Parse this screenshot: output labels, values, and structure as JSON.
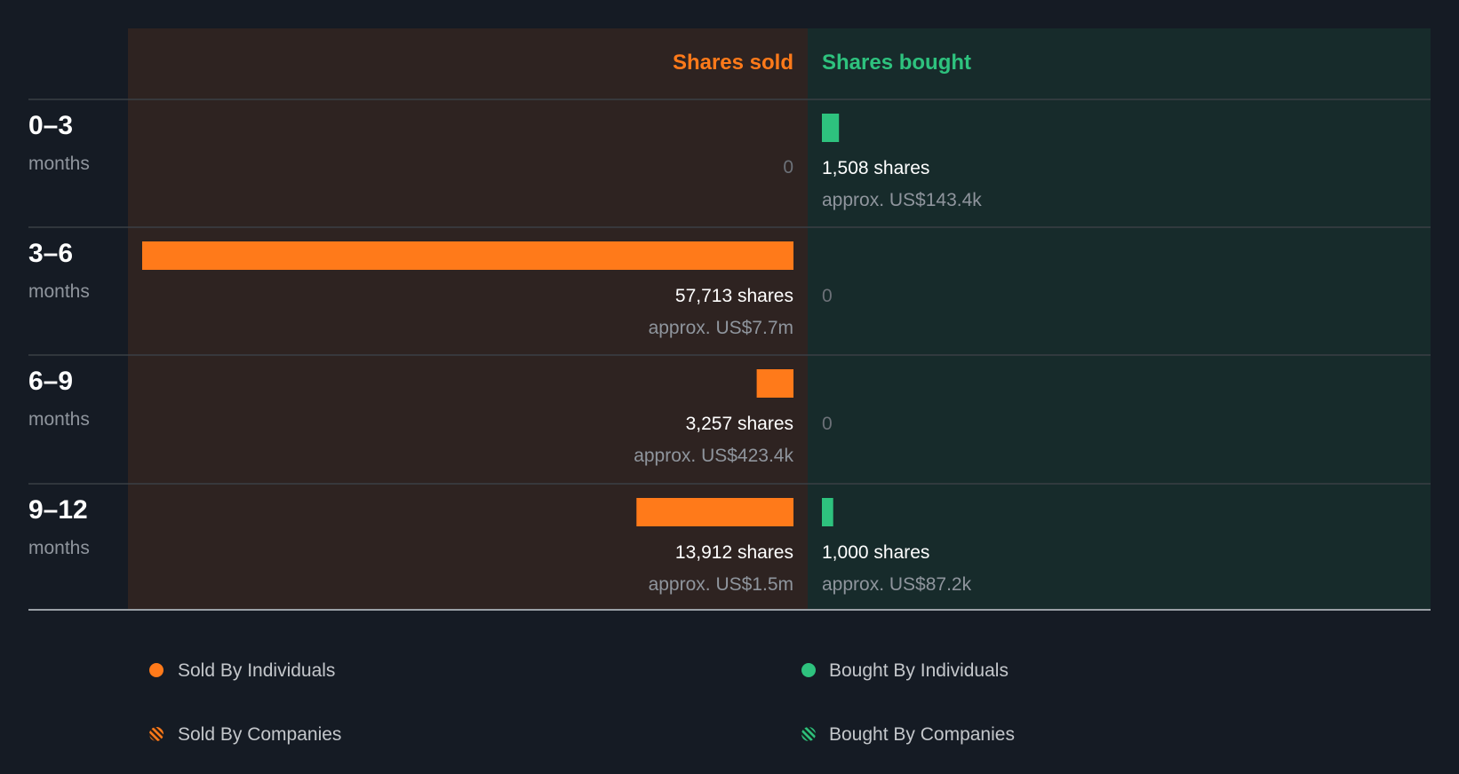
{
  "chart_data": {
    "type": "bar",
    "title": "",
    "columns": {
      "sold": "Shares sold",
      "bought": "Shares bought"
    },
    "periods": [
      {
        "range": "0–3",
        "unit": "months",
        "sold": {
          "shares": 0,
          "label": "0",
          "value": ""
        },
        "bought": {
          "shares": 1508,
          "label": "1,508 shares",
          "value": "approx. US$143.4k"
        }
      },
      {
        "range": "3–6",
        "unit": "months",
        "sold": {
          "shares": 57713,
          "label": "57,713 shares",
          "value": "approx. US$7.7m"
        },
        "bought": {
          "shares": 0,
          "label": "0",
          "value": ""
        }
      },
      {
        "range": "6–9",
        "unit": "months",
        "sold": {
          "shares": 3257,
          "label": "3,257 shares",
          "value": "approx. US$423.4k"
        },
        "bought": {
          "shares": 0,
          "label": "0",
          "value": ""
        }
      },
      {
        "range": "9–12",
        "unit": "months",
        "sold": {
          "shares": 13912,
          "label": "13,912 shares",
          "value": "approx. US$1.5m"
        },
        "bought": {
          "shares": 1000,
          "label": "1,000 shares",
          "value": "approx. US$87.2k"
        }
      }
    ],
    "legend": [
      {
        "label": "Sold By Individuals",
        "marker": "solid-dot",
        "color": "#ff7a1a"
      },
      {
        "label": "Bought By Individuals",
        "marker": "solid-dot",
        "color": "#2ec27e"
      },
      {
        "label": "Sold By Companies",
        "marker": "striped-dot",
        "color": "#ff7a1a"
      },
      {
        "label": "Bought By Companies",
        "marker": "striped-dot",
        "color": "#2ec27e"
      }
    ],
    "colors": {
      "sold": "#ff7a1a",
      "bought": "#2ec27e",
      "sold_panel": "#2e2321",
      "bought_panel": "#172b2b",
      "background": "#151b24"
    }
  }
}
